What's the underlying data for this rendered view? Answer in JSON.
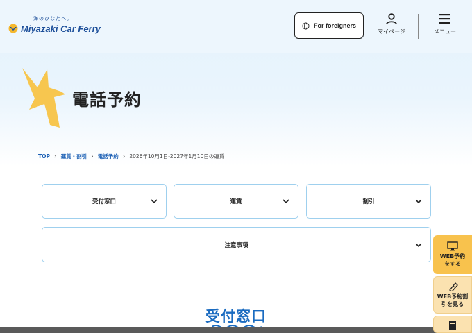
{
  "header": {
    "logo_tagline": "海のひなたへ。",
    "logo_text": "Miyazaki Car Ferry",
    "foreigners_label": "For foreigners",
    "mypage_label": "マイページ",
    "menu_label": "メニュー"
  },
  "hero": {
    "title": "電話予約"
  },
  "breadcrumb": [
    {
      "label": "TOP"
    },
    {
      "label": "運賃・割引"
    },
    {
      "label": "電話予約"
    },
    {
      "label": "2026年10月1日-2027年1月10日の運賃"
    }
  ],
  "nav": {
    "items": [
      {
        "label": "受付窓口"
      },
      {
        "label": "運賃"
      },
      {
        "label": "割引"
      },
      {
        "label": "注意事項"
      }
    ]
  },
  "section": {
    "title": "受付窓口"
  },
  "side": {
    "web_reserve": [
      "WEB予約",
      "をする"
    ],
    "web_discount": [
      "WEB予約割",
      "引を見る"
    ]
  },
  "colors": {
    "brand_blue": "#1d4f9a",
    "accent_yellow": "#f8c24d",
    "border_blue": "#9fd0ee",
    "section_blue": "#1a6bc0"
  },
  "icons": [
    "globe-icon",
    "user-icon",
    "hamburger-icon",
    "bird-icon",
    "chevron-down-icon",
    "monitor-icon",
    "ticket-icon",
    "book-icon"
  ]
}
